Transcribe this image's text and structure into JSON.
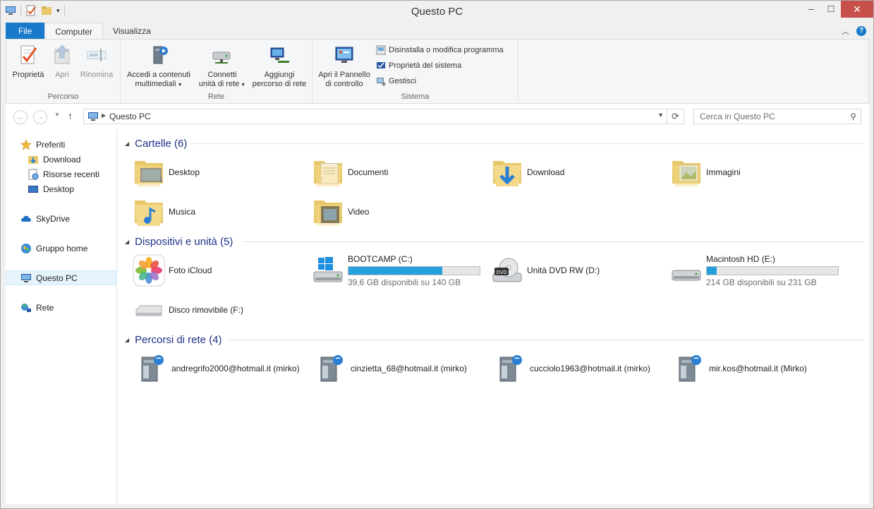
{
  "window": {
    "title": "Questo PC"
  },
  "ribbon_tabs": [
    {
      "label": "File"
    },
    {
      "label": "Computer"
    },
    {
      "label": "Visualizza"
    }
  ],
  "ribbon": {
    "percorso": {
      "label": "Percorso",
      "buttons": [
        {
          "label": "Proprietà",
          "icon": "properties-icon"
        },
        {
          "label": "Apri",
          "icon": "open-icon"
        },
        {
          "label": "Rinomina",
          "icon": "rename-icon"
        }
      ]
    },
    "rete": {
      "label": "Rete",
      "buttons": [
        {
          "line1": "Accedi a contenuti",
          "line2": "multimediali",
          "icon": "media-access-icon"
        },
        {
          "line1": "Connetti",
          "line2": "unità di rete",
          "icon": "map-network-drive-icon"
        },
        {
          "line1": "Aggiungi",
          "line2": "percorso di rete",
          "icon": "add-network-location-icon"
        }
      ]
    },
    "sistema": {
      "label": "Sistema",
      "big_button": {
        "line1": "Apri il Pannello",
        "line2": "di controllo",
        "icon": "control-panel-icon"
      },
      "small_buttons": [
        {
          "label": "Disinstalla o modifica programma",
          "icon": "uninstall-icon"
        },
        {
          "label": "Proprietà del sistema",
          "icon": "system-properties-icon"
        },
        {
          "label": "Gestisci",
          "icon": "manage-icon"
        }
      ]
    }
  },
  "address": {
    "crumb": "Questo PC"
  },
  "search": {
    "placeholder": "Cerca in Questo PC"
  },
  "nav": {
    "favorites": {
      "label": "Preferiti",
      "items": [
        "Download",
        "Risorse recenti",
        "Desktop"
      ]
    },
    "skydrive": "SkyDrive",
    "homegroup": "Gruppo home",
    "thispc": "Questo PC",
    "network": "Rete"
  },
  "sections": {
    "folders": {
      "title": "Cartelle (6)",
      "items": [
        "Desktop",
        "Documenti",
        "Download",
        "Immagini",
        "Musica",
        "Video"
      ]
    },
    "devices": {
      "title": "Dispositivi e unità (5)",
      "items": [
        {
          "name": "Foto iCloud"
        },
        {
          "name": "BOOTCAMP (C:)",
          "info": "39,6 GB disponibili su 140 GB",
          "used_fraction": 0.717
        },
        {
          "name": "Unità DVD RW (D:)"
        },
        {
          "name": "Macintosh HD (E:)",
          "info": "214 GB disponibili su 231 GB",
          "used_fraction": 0.074
        },
        {
          "name": "Disco rimovibile (F:)"
        }
      ]
    },
    "network": {
      "title": "Percorsi di rete (4)",
      "items": [
        "andregrifo2000@hotmail.it (mirko)",
        "cinzietta_68@hotmail.it (mirko)",
        "cucciolo1963@hotmail.it (mirko)",
        "mir.kos@hotmail.it (Mirko)"
      ]
    }
  },
  "colors": {
    "accent": "#1979ca",
    "section_title": "#1e3287",
    "bar_fill": "#26a0da",
    "close_button": "#c7504a"
  }
}
